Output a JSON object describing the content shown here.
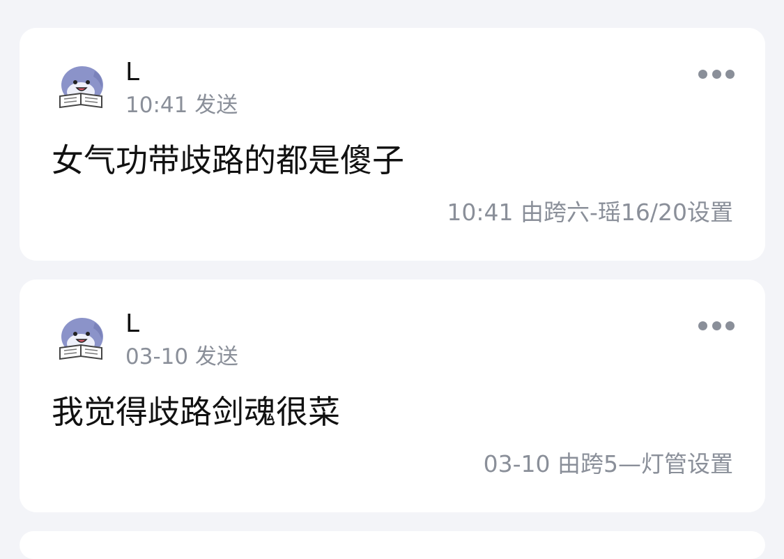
{
  "posts": [
    {
      "author": "L",
      "avatar_icon": "shark-reading-avatar-icon",
      "sent_meta": "10:41 发送",
      "message": "女气功带歧路的都是傻子",
      "footer": "10:41 由跨六-瑶16/20设置",
      "more_icon": "more-options-icon"
    },
    {
      "author": "L",
      "avatar_icon": "shark-reading-avatar-icon",
      "sent_meta": "03-10 发送",
      "message": "我觉得歧路剑魂很菜",
      "footer": "03-10 由跨5—灯管设置",
      "more_icon": "more-options-icon"
    }
  ],
  "colors": {
    "background": "#f3f4f8",
    "card": "#ffffff",
    "primary_text": "#111111",
    "secondary_text": "#8a8f99",
    "avatar_body": "#8b93c9"
  }
}
